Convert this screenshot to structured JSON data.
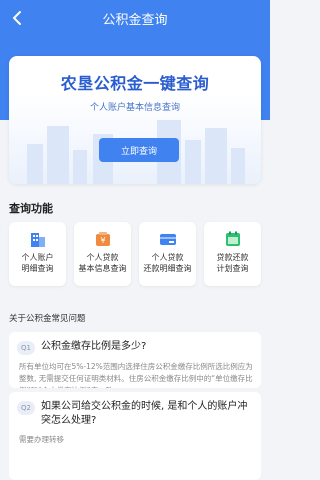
{
  "nav": {
    "title": "公积金查询",
    "back_icon": "chevron-left-icon"
  },
  "hero": {
    "title": "农垦公积金一键查询",
    "subtitle": "个人账户基本信息查询",
    "button": "立即查询"
  },
  "functions": {
    "title": "查询功能",
    "items": [
      {
        "icon": "building-icon",
        "line1": "个人账户",
        "line2": "明细查询",
        "color": "#3f82f0"
      },
      {
        "icon": "money-bag-icon",
        "line1": "个人贷款",
        "line2": "基本信息查询",
        "color": "#f08a3f"
      },
      {
        "icon": "card-icon",
        "line1": "个人贷款",
        "line2": "还款明细查询",
        "color": "#3f82f0"
      },
      {
        "icon": "calendar-icon",
        "line1": "贷款还款",
        "line2": "计划查询",
        "color": "#2fbf71"
      }
    ]
  },
  "faq": {
    "title": "关于公积金常见问题",
    "items": [
      {
        "badge": "Q1",
        "question": "公积金缴存比例是多少?",
        "answer": "所有单位均可在5%-12%范围内选择住房公积金缴存比例所选比例应为整数, 无需提交任何证明类材料。住房公积金缴存比例中的“单位缴存比例”和“个人缴存比例”应一致"
      },
      {
        "badge": "Q2",
        "question": "如果公司给交公积金的时候, 是和个人的账户冲突怎么处理?",
        "answer": "需要办理转移"
      }
    ]
  }
}
